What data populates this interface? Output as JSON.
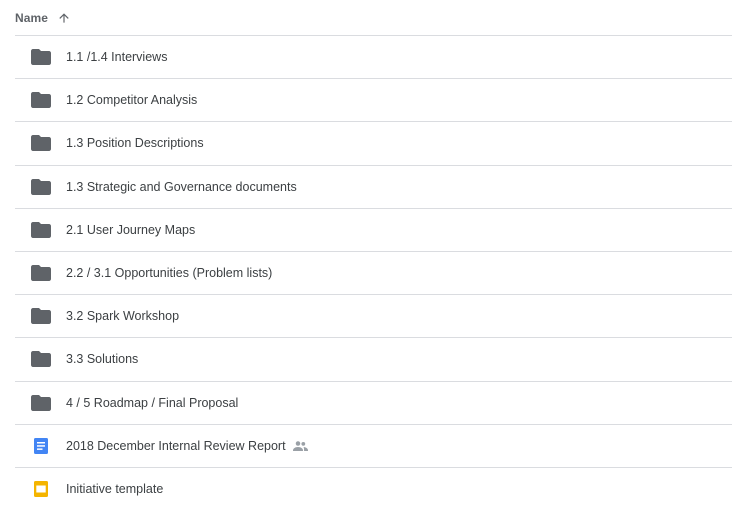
{
  "header": {
    "name_label": "Name",
    "sort_icon": "arrow-upward-icon"
  },
  "colors": {
    "folder": "#5f6368",
    "doc": "#4285f4",
    "slides": "#f4b400",
    "divider": "#dadce0"
  },
  "files": [
    {
      "name": "1.1 /1.4 Interviews",
      "type": "folder",
      "icon": "folder-icon",
      "shared": false
    },
    {
      "name": "1.2 Competitor Analysis",
      "type": "folder",
      "icon": "folder-icon",
      "shared": false
    },
    {
      "name": "1.3 Position Descriptions",
      "type": "folder",
      "icon": "folder-icon",
      "shared": false
    },
    {
      "name": "1.3 Strategic and Governance documents",
      "type": "folder",
      "icon": "folder-icon",
      "shared": false
    },
    {
      "name": "2.1 User Journey Maps",
      "type": "folder",
      "icon": "folder-icon",
      "shared": false
    },
    {
      "name": "2.2 / 3.1 Opportunities (Problem lists)",
      "type": "folder",
      "icon": "folder-icon",
      "shared": false
    },
    {
      "name": "3.2 Spark Workshop",
      "type": "folder",
      "icon": "folder-icon",
      "shared": false
    },
    {
      "name": "3.3 Solutions",
      "type": "folder",
      "icon": "folder-icon",
      "shared": false
    },
    {
      "name": "4 / 5 Roadmap / Final Proposal",
      "type": "folder",
      "icon": "folder-icon",
      "shared": false
    },
    {
      "name": "2018 December Internal Review Report",
      "type": "doc",
      "icon": "google-docs-icon",
      "shared": true,
      "shared_icon": "shared-people-icon"
    },
    {
      "name": "Initiative template",
      "type": "slides",
      "icon": "google-slides-icon",
      "shared": false
    }
  ]
}
